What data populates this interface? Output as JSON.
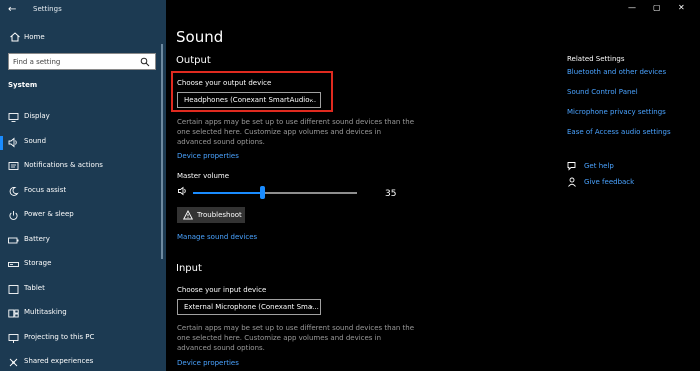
{
  "window": {
    "title": "Settings",
    "minimize": "—",
    "maximize": "▢",
    "close": "✕"
  },
  "sidebar": {
    "home_label": "Home",
    "search_placeholder": "Find a setting",
    "section": "System",
    "items": [
      {
        "label": "Display",
        "icon": "display-icon",
        "active": false
      },
      {
        "label": "Sound",
        "icon": "speaker-icon",
        "active": true
      },
      {
        "label": "Notifications & actions",
        "icon": "notifications-icon",
        "active": false
      },
      {
        "label": "Focus assist",
        "icon": "moon-icon",
        "active": false
      },
      {
        "label": "Power & sleep",
        "icon": "power-icon",
        "active": false
      },
      {
        "label": "Battery",
        "icon": "battery-icon",
        "active": false
      },
      {
        "label": "Storage",
        "icon": "storage-icon",
        "active": false
      },
      {
        "label": "Tablet",
        "icon": "tablet-icon",
        "active": false
      },
      {
        "label": "Multitasking",
        "icon": "multitasking-icon",
        "active": false
      },
      {
        "label": "Projecting to this PC",
        "icon": "projecting-icon",
        "active": false
      },
      {
        "label": "Shared experiences",
        "icon": "shared-icon",
        "active": false
      }
    ]
  },
  "main": {
    "title": "Sound",
    "output": {
      "heading": "Output",
      "device_label": "Choose your output device",
      "device_value": "Headphones (Conexant SmartAudio...",
      "description": "Certain apps may be set up to use different sound devices than the one selected here. Customize app volumes and devices in advanced sound options.",
      "properties_link": "Device properties",
      "volume_label": "Master volume",
      "volume_value": "35",
      "volume_fraction": 0.42,
      "troubleshoot_label": "Troubleshoot",
      "manage_link": "Manage sound devices"
    },
    "input": {
      "heading": "Input",
      "device_label": "Choose your input device",
      "device_value": "External Microphone (Conexant Sma...",
      "description": "Certain apps may be set up to use different sound devices than the one selected here. Customize app volumes and devices in advanced sound options.",
      "properties_link": "Device properties"
    }
  },
  "related": {
    "title": "Related Settings",
    "links": [
      "Bluetooth and other devices",
      "Sound Control Panel",
      "Microphone privacy settings",
      "Ease of Access audio settings"
    ],
    "help_label": "Get help",
    "feedback_label": "Give feedback"
  },
  "colors": {
    "sidebar": "#1c3a52",
    "accent": "#1a8cff",
    "link": "#4aa3ff",
    "highlight": "#e02a1f"
  }
}
